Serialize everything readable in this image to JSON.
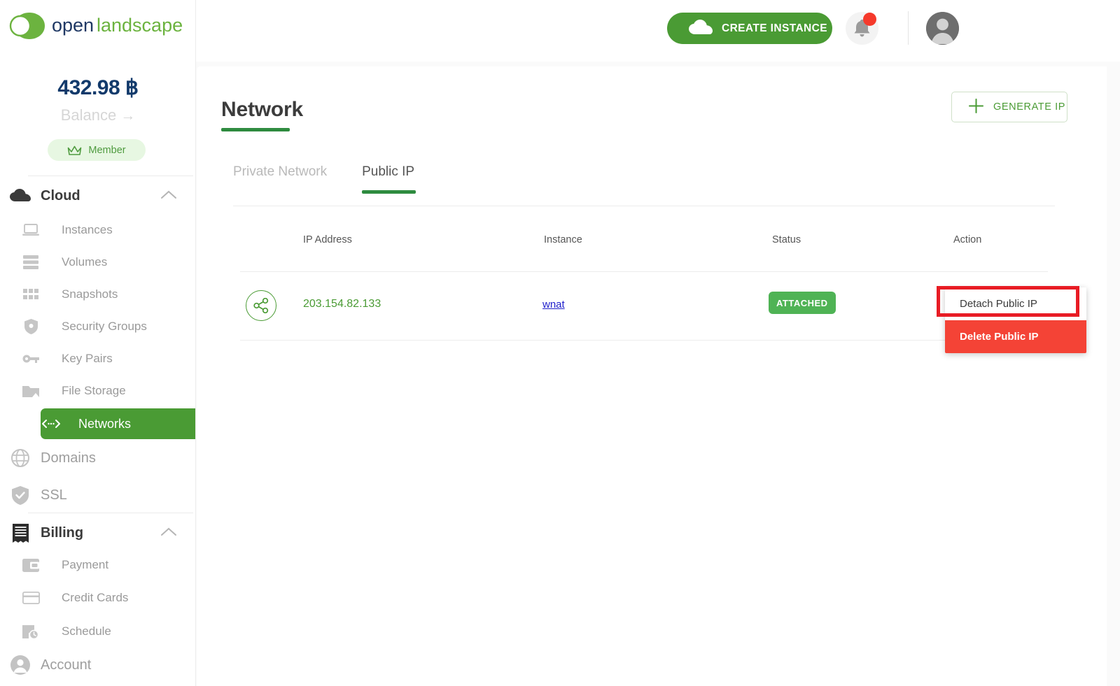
{
  "brand": {
    "name_part1": "open",
    "name_part2": "landscape"
  },
  "sidebar": {
    "balance_amount": "432.98 ฿",
    "balance_label": "Balance",
    "balance_arrow": "→",
    "member_label": "Member",
    "groups": [
      {
        "label": "Cloud",
        "icon": "cloud-icon",
        "items": [
          {
            "label": "Instances",
            "icon": "laptop-icon"
          },
          {
            "label": "Volumes",
            "icon": "server-stack-icon"
          },
          {
            "label": "Snapshots",
            "icon": "grid-icon"
          },
          {
            "label": "Security Groups",
            "icon": "shield-icon"
          },
          {
            "label": "Key Pairs",
            "icon": "key-icon"
          },
          {
            "label": "File Storage",
            "icon": "folder-icon"
          },
          {
            "label": "Networks",
            "icon": "code-arrows-icon",
            "active": true
          }
        ]
      }
    ],
    "top_level": [
      {
        "label": "Domains",
        "icon": "globe-icon"
      },
      {
        "label": "SSL",
        "icon": "shield-check-icon"
      }
    ],
    "billing": {
      "label": "Billing",
      "icon": "receipt-icon",
      "items": [
        {
          "label": "Payment",
          "icon": "wallet-icon"
        },
        {
          "label": "Credit Cards",
          "icon": "credit-card-icon"
        },
        {
          "label": "Schedule",
          "icon": "calendar-clock-icon"
        }
      ]
    },
    "account": {
      "label": "Account",
      "icon": "account-circle-icon"
    }
  },
  "topbar": {
    "create_instance_label": "CREATE INSTANCE",
    "create_instance_icon": "cloud-icon",
    "notification_icon": "bell-icon",
    "notification_has_badge": true,
    "avatar_icon": "user-avatar"
  },
  "main": {
    "page_title": "Network",
    "generate_ip_label": "GENERATE IP",
    "generate_ip_icon": "plus-icon",
    "tabs": [
      {
        "label": "Private Network",
        "active": false
      },
      {
        "label": "Public IP",
        "active": true
      }
    ],
    "table": {
      "columns": [
        "IP Address",
        "Instance",
        "Status",
        "Action"
      ],
      "rows": [
        {
          "icon": "share-nodes-icon",
          "ip_address": "203.154.82.133",
          "instance": "wnat",
          "status": "ATTACHED"
        }
      ]
    },
    "action_menu": {
      "items": [
        {
          "label": "Detach Public IP",
          "variant": "default",
          "highlighted": true
        },
        {
          "label": "Delete Public IP",
          "variant": "danger",
          "highlighted": false
        }
      ]
    }
  },
  "colors": {
    "brand_green": "#4a9b34",
    "accent_green_dark": "#2e8b3f",
    "badge_green": "#4fb355",
    "danger_red": "#f44336",
    "highlight_red": "#e81c24",
    "balance_navy": "#123a6b",
    "link_blue": "#2222cc"
  }
}
